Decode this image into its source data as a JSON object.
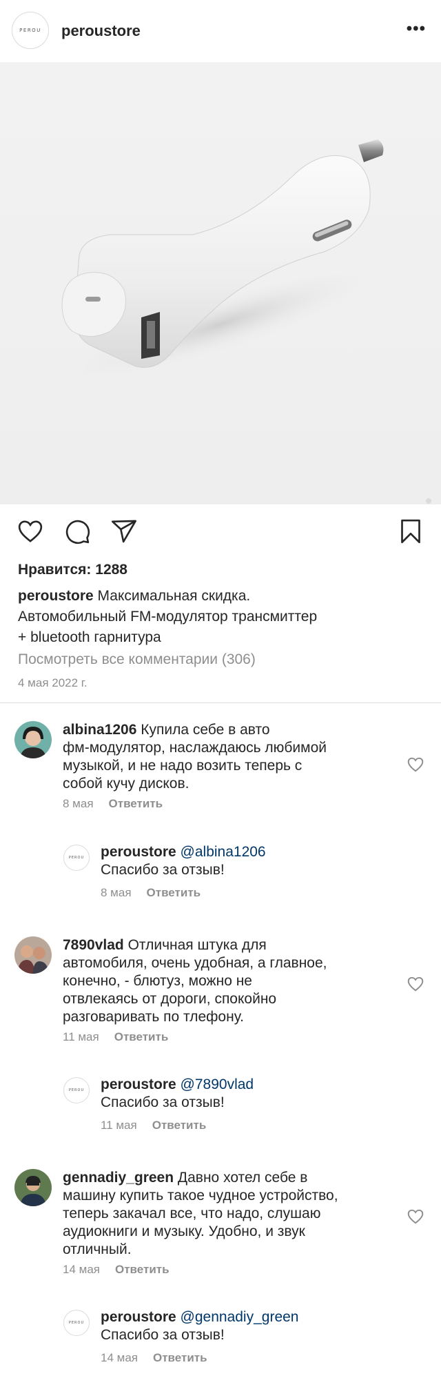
{
  "header": {
    "logo_text": "PEROU",
    "username": "peroustore",
    "more_icon": "more-horizontal-icon"
  },
  "photo": {
    "description_icon": "car-charger-photo"
  },
  "actions": {
    "like": "heart-icon",
    "comment": "comment-icon",
    "share": "send-icon",
    "save": "bookmark-icon"
  },
  "post": {
    "likes": "Нравится: 1288",
    "author": "peroustore",
    "caption_1": "Максимальная скидка.",
    "caption_2": "Автомобильный FM-модулятор трансмиттер",
    "caption_3": "+ bluetooth гарнитура",
    "view_all": "Посмотреть все комментарии (306)",
    "date": "4 мая 2022 г."
  },
  "comments": [
    {
      "user": "albina1206",
      "text_1": "Купила себе в авто",
      "text_2": "фм-модулятор, наслаждаюсь любимой",
      "text_3": "музыкой, и не надо возить теперь с",
      "text_4": "собой кучу дисков.",
      "date": "8 мая",
      "reply": "Ответить",
      "answer": {
        "user": "peroustore",
        "mention": "@albina1206",
        "text": "Спасибо за отзыв!",
        "date": "8 мая",
        "reply": "Ответить"
      }
    },
    {
      "user": "7890vlad",
      "text_1": "Отличная штука для",
      "text_2": "автомобиля, очень удобная, а главное,",
      "text_3": "конечно, - блютуз, можно не",
      "text_4": "отвлекаясь от дороги, спокойно",
      "text_5": "разговаривать по тлефону.",
      "date": "11 мая",
      "reply": "Ответить",
      "answer": {
        "user": "peroustore",
        "mention": "@7890vlad",
        "text": "Спасибо за отзыв!",
        "date": "11 мая",
        "reply": "Ответить"
      }
    },
    {
      "user": "gennadiy_green",
      "text_1": "Давно хотел себе в",
      "text_2": "машину купить такое чудное устройство,",
      "text_3": "теперь закачал все, что надо, слушаю",
      "text_4": "аудиокниги и музыку. Удобно, и звук",
      "text_5": "отличный.",
      "date": "14 мая",
      "reply": "Ответить",
      "answer": {
        "user": "peroustore",
        "mention": "@gennadiy_green",
        "text": "Спасибо за отзыв!",
        "date": "14 мая",
        "reply": "Ответить"
      }
    }
  ]
}
